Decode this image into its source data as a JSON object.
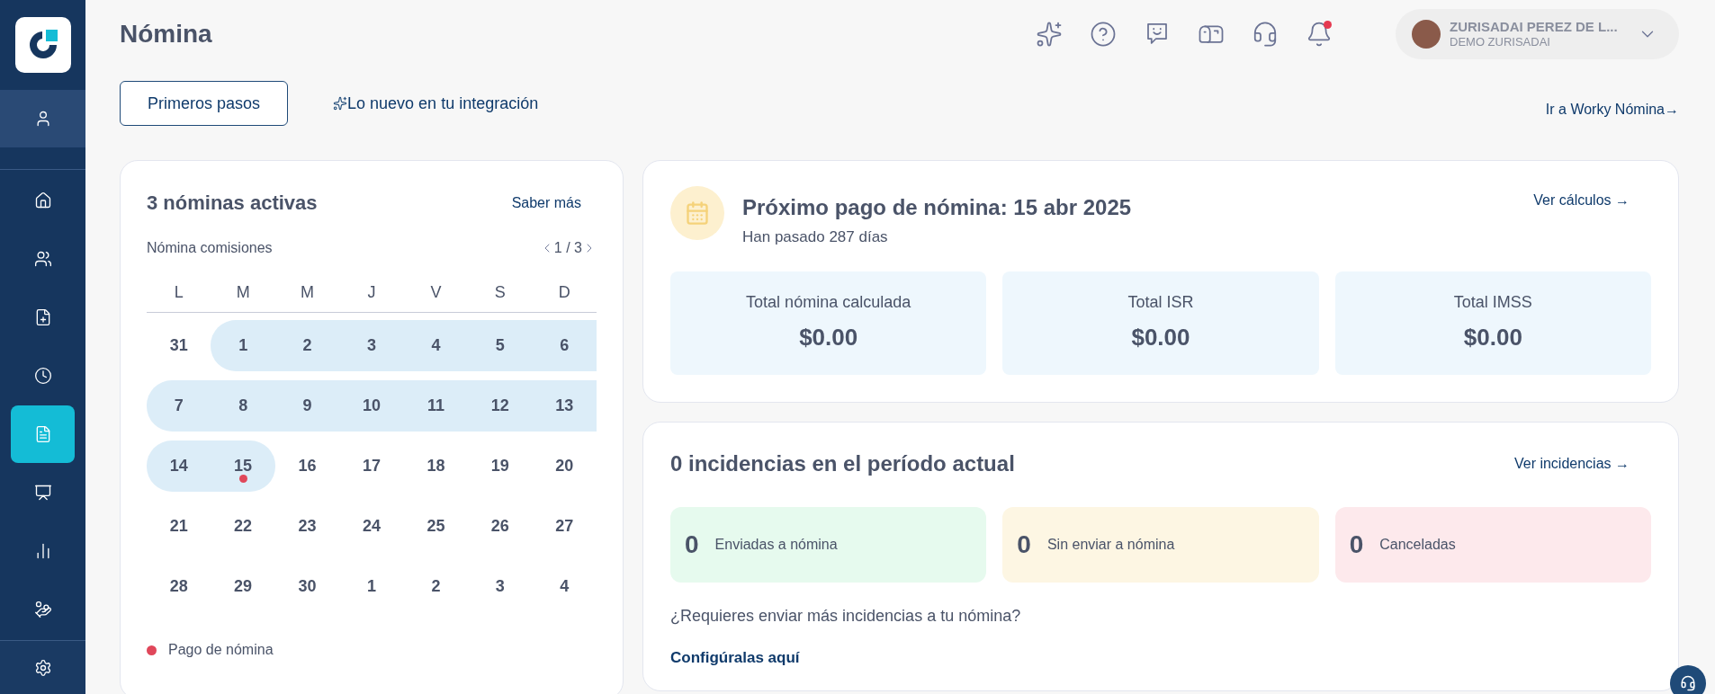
{
  "sidebar": {
    "items": [
      {
        "kind": "user",
        "selected": false
      },
      {
        "kind": "home",
        "selected": false
      },
      {
        "kind": "people",
        "selected": false
      },
      {
        "kind": "file-plus",
        "selected": false
      },
      {
        "kind": "clock",
        "selected": false
      },
      {
        "kind": "payroll",
        "selected": true
      },
      {
        "kind": "presentation",
        "selected": false
      },
      {
        "kind": "chart",
        "selected": false
      },
      {
        "kind": "hand-coins",
        "selected": false
      },
      {
        "kind": "settings",
        "selected": false
      }
    ]
  },
  "header": {
    "title": "Nómina",
    "user_name": "ZURISADAI PEREZ DE L...",
    "user_company": "DEMO ZURISADAI",
    "notification_badge": true
  },
  "actions": {
    "first_steps": "Primeros pasos",
    "whats_new": "Lo nuevo en tu integración",
    "go_link": "Ir a Worky Nómina→"
  },
  "calendar_card": {
    "title": "3 nóminas activas",
    "more_link": "Saber más",
    "payroll_name": "Nómina comisiones",
    "pager": "1 / 3",
    "weekdays": [
      "L",
      "M",
      "M",
      "J",
      "V",
      "S",
      "D"
    ],
    "weeks": [
      [
        {
          "label": "31",
          "highlighted": false,
          "payday": false
        },
        {
          "label": "1",
          "highlighted": true,
          "payday": false
        },
        {
          "label": "2",
          "highlighted": true,
          "payday": false
        },
        {
          "label": "3",
          "highlighted": true,
          "payday": false
        },
        {
          "label": "4",
          "highlighted": true,
          "payday": false
        },
        {
          "label": "5",
          "highlighted": true,
          "payday": false
        },
        {
          "label": "6",
          "highlighted": true,
          "payday": false
        }
      ],
      [
        {
          "label": "7",
          "highlighted": true,
          "payday": false
        },
        {
          "label": "8",
          "highlighted": true,
          "payday": false
        },
        {
          "label": "9",
          "highlighted": true,
          "payday": false
        },
        {
          "label": "10",
          "highlighted": true,
          "payday": false
        },
        {
          "label": "11",
          "highlighted": true,
          "payday": false
        },
        {
          "label": "12",
          "highlighted": true,
          "payday": false
        },
        {
          "label": "13",
          "highlighted": true,
          "payday": false
        }
      ],
      [
        {
          "label": "14",
          "highlighted": true,
          "payday": false
        },
        {
          "label": "15",
          "highlighted": true,
          "payday": true
        },
        {
          "label": "16",
          "highlighted": false,
          "payday": false
        },
        {
          "label": "17",
          "highlighted": false,
          "payday": false
        },
        {
          "label": "18",
          "highlighted": false,
          "payday": false
        },
        {
          "label": "19",
          "highlighted": false,
          "payday": false
        },
        {
          "label": "20",
          "highlighted": false,
          "payday": false
        }
      ],
      [
        {
          "label": "21",
          "highlighted": false,
          "payday": false
        },
        {
          "label": "22",
          "highlighted": false,
          "payday": false
        },
        {
          "label": "23",
          "highlighted": false,
          "payday": false
        },
        {
          "label": "24",
          "highlighted": false,
          "payday": false
        },
        {
          "label": "25",
          "highlighted": false,
          "payday": false
        },
        {
          "label": "26",
          "highlighted": false,
          "payday": false
        },
        {
          "label": "27",
          "highlighted": false,
          "payday": false
        }
      ],
      [
        {
          "label": "28",
          "highlighted": false,
          "payday": false
        },
        {
          "label": "29",
          "highlighted": false,
          "payday": false
        },
        {
          "label": "30",
          "highlighted": false,
          "payday": false
        },
        {
          "label": "1",
          "highlighted": false,
          "payday": false
        },
        {
          "label": "2",
          "highlighted": false,
          "payday": false
        },
        {
          "label": "3",
          "highlighted": false,
          "payday": false
        },
        {
          "label": "4",
          "highlighted": false,
          "payday": false
        }
      ]
    ],
    "legend": [
      {
        "label": "Pago de nómina",
        "color": "#e0475a"
      }
    ]
  },
  "next_payment": {
    "title": "Próximo pago de nómina: 15 abr 2025",
    "subtitle": "Han pasado 287 días",
    "link": "Ver cálculos →",
    "totals": [
      {
        "label": "Total nómina calculada",
        "value": "$0.00"
      },
      {
        "label": "Total ISR",
        "value": "$0.00"
      },
      {
        "label": "Total IMSS",
        "value": "$0.00"
      }
    ]
  },
  "incidents": {
    "title": "0 incidencias en el período actual",
    "link": "Ver incidencias →",
    "counts": [
      {
        "count": "0",
        "label": "Enviadas a nómina",
        "color": "#e6faee"
      },
      {
        "count": "0",
        "label": "Sin enviar a nómina",
        "color": "#fdf6e3"
      },
      {
        "count": "0",
        "label": "Canceladas",
        "color": "#fde9ec"
      }
    ],
    "question": "¿Requieres enviar más incidencias a tu nómina?",
    "config_link": "Configúralas aquí"
  }
}
